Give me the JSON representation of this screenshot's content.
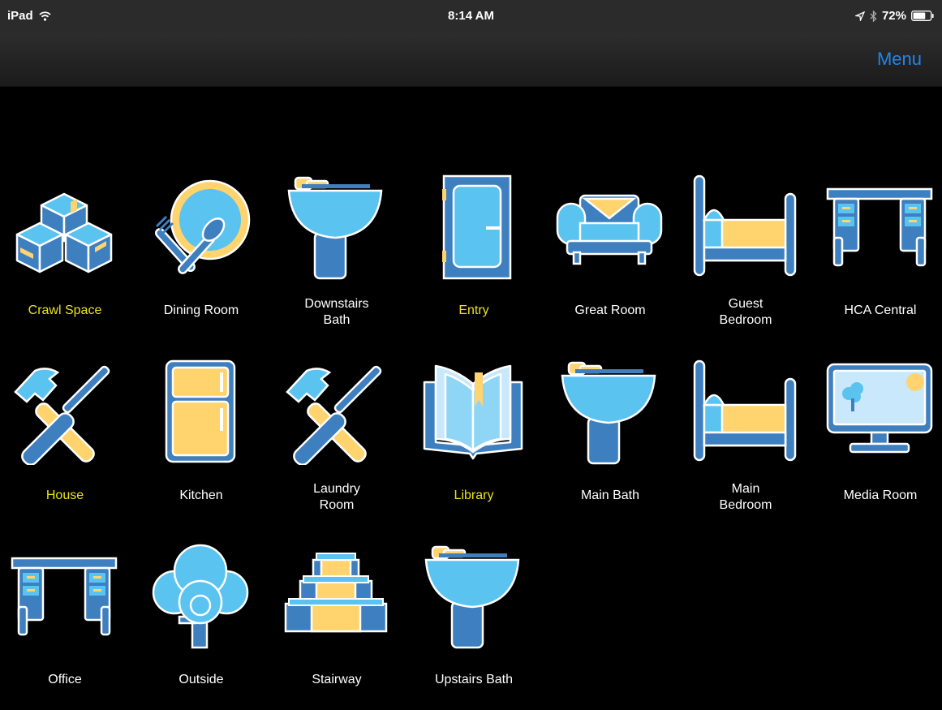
{
  "status_bar": {
    "device": "iPad",
    "time": "8:14 AM",
    "battery": "72%",
    "battery_level": 0.72
  },
  "nav": {
    "menu_label": "Menu"
  },
  "colors": {
    "highlight_label": "#e9e31a",
    "normal_label": "#ffffff",
    "menu_link": "#1f86ee"
  },
  "rooms": [
    {
      "label": "Crawl Space",
      "icon": "boxes-icon",
      "highlighted": true
    },
    {
      "label": "Dining Room",
      "icon": "plate-utensils-icon",
      "highlighted": false
    },
    {
      "label": "Downstairs\nBath",
      "icon": "sink-icon",
      "highlighted": false
    },
    {
      "label": "Entry",
      "icon": "door-icon",
      "highlighted": true
    },
    {
      "label": "Great Room",
      "icon": "armchair-icon",
      "highlighted": false
    },
    {
      "label": "Guest\nBedroom",
      "icon": "bed-icon",
      "highlighted": false
    },
    {
      "label": "HCA Central",
      "icon": "desk-icon",
      "highlighted": false
    },
    {
      "label": "House",
      "icon": "tools-icon",
      "highlighted": true
    },
    {
      "label": "Kitchen",
      "icon": "refrigerator-icon",
      "highlighted": false
    },
    {
      "label": "Laundry\nRoom",
      "icon": "tools-icon",
      "highlighted": false
    },
    {
      "label": "Library",
      "icon": "book-icon",
      "highlighted": true
    },
    {
      "label": "Main Bath",
      "icon": "sink-icon",
      "highlighted": false
    },
    {
      "label": "Main\nBedroom",
      "icon": "bed-icon",
      "highlighted": false
    },
    {
      "label": "Media Room",
      "icon": "monitor-icon",
      "highlighted": false
    },
    {
      "label": "Office",
      "icon": "desk-icon",
      "highlighted": false
    },
    {
      "label": "Outside",
      "icon": "tree-icon",
      "highlighted": false
    },
    {
      "label": "Stairway",
      "icon": "stairs-icon",
      "highlighted": false
    },
    {
      "label": "Upstairs Bath",
      "icon": "sink-icon",
      "highlighted": false
    }
  ]
}
